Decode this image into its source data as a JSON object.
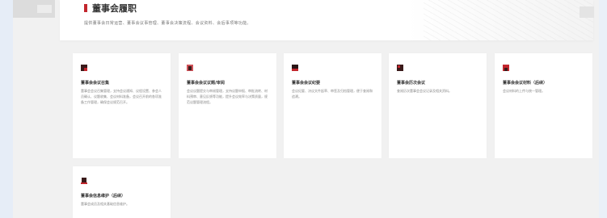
{
  "page": {
    "title": "董事会履职",
    "description": "提供董事会日常运营、董事会议事管理、董事会决策流程、会议资料、会后事项等功能。"
  },
  "cards": [
    {
      "title": "董事会会议召集",
      "description": "董事会会议召集管理，支持会议通知、议程设置、参会人员确认、议题收集、会议材料准备，会议召开前的各项准备工作管理，确保会议规范召开。",
      "icon": "meeting-convene-icon"
    },
    {
      "title": "董事会会议议题/审阅",
      "description": "会议议题提交与审阅管理，支持议题申报、审批流转、材料预审、意见反馈等功能，提升会议效率与决策质量，规范议题管理流程。",
      "icon": "agenda-review-icon"
    },
    {
      "title": "董事会会议纪要",
      "description": "会议纪要、决议文件起草、审签及归档管理，便于查阅和追溯。",
      "icon": "minutes-icon"
    },
    {
      "title": "董事会历次会议",
      "description": "查阅历次董事会会议记录及相关资料。",
      "icon": "history-meetings-icon"
    },
    {
      "title": "董事会会议材料（后续）",
      "description": "会议材料的上传与统一管理。",
      "icon": "meeting-materials-icon"
    },
    {
      "title": "董事会信息维护（后续）",
      "description": "董事会成员及相关基础信息维护。",
      "icon": "info-maintenance-icon"
    }
  ],
  "colors": {
    "accent": "#c2262d",
    "background": "#f1f1f1",
    "card": "#ffffff"
  }
}
